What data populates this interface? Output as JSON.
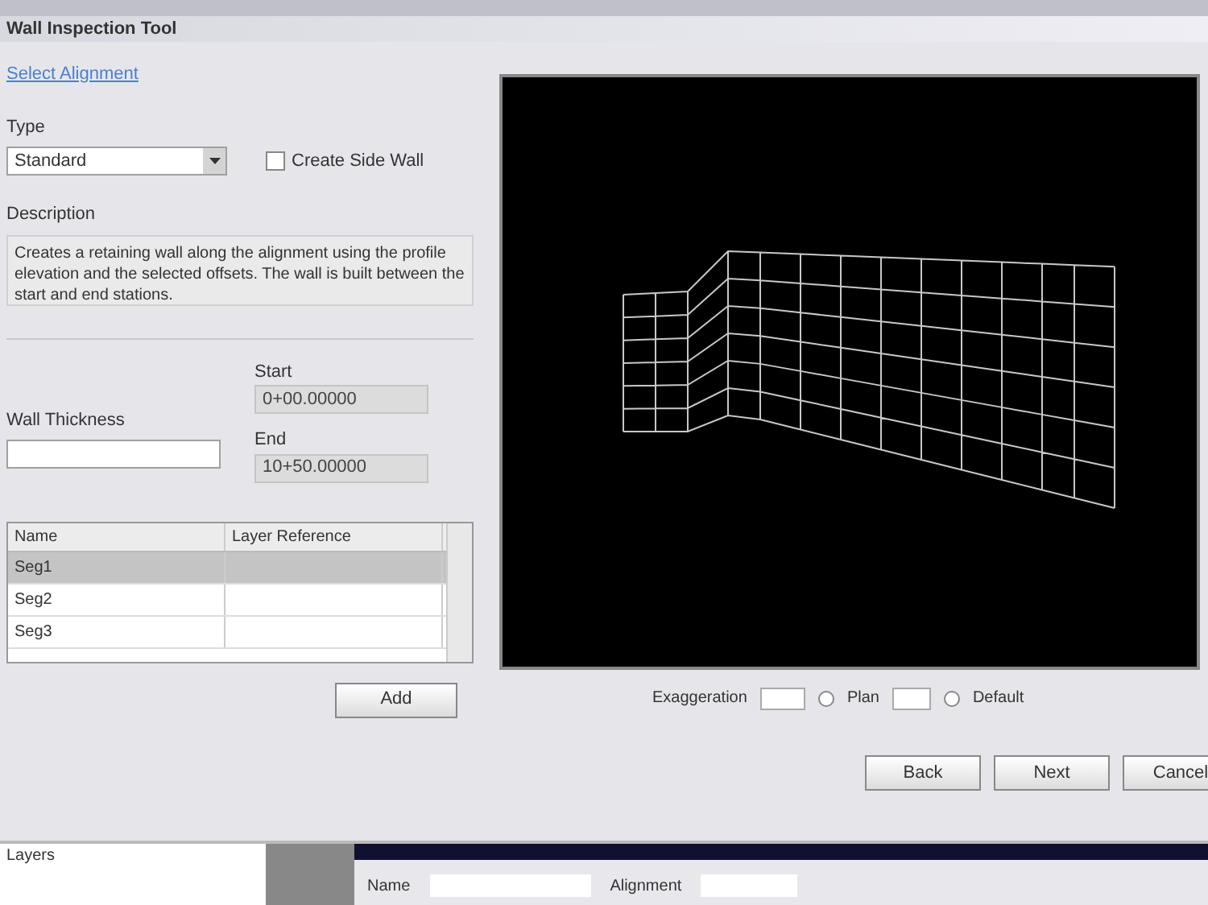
{
  "window": {
    "title": "Wall Inspection Tool"
  },
  "link": "Select Alignment",
  "type_field": {
    "label": "Type",
    "value": "Standard"
  },
  "side_wall": {
    "label": "Create Side Wall",
    "checked": false
  },
  "description": {
    "label": "Description",
    "text": "Creates a retaining wall along the alignment using the profile elevation and the selected offsets. The wall is built between the start and end stations."
  },
  "start": {
    "label": "Start",
    "value": "0+00.00000"
  },
  "end": {
    "label": "End",
    "value": "10+50.00000"
  },
  "thickness": {
    "label": "Wall Thickness"
  },
  "table": {
    "columns": [
      "Name",
      "Layer Reference"
    ],
    "rows": [
      {
        "cells": [
          "Seg1"
        ],
        "selected": true
      },
      {
        "cells": [
          "Seg2"
        ],
        "selected": false
      },
      {
        "cells": [
          "Seg3"
        ],
        "selected": false
      }
    ]
  },
  "add_button": "Add",
  "viewport_controls": {
    "exaggeration_label": "Exaggeration",
    "plan": {
      "label": "Plan",
      "selected": false
    },
    "default": {
      "label": "Default",
      "selected": false
    }
  },
  "buttons": [
    "Back",
    "Next",
    "Cancel"
  ],
  "background": {
    "panel_label": "Layers",
    "field_label": "Name",
    "field2_label": "Alignment"
  }
}
